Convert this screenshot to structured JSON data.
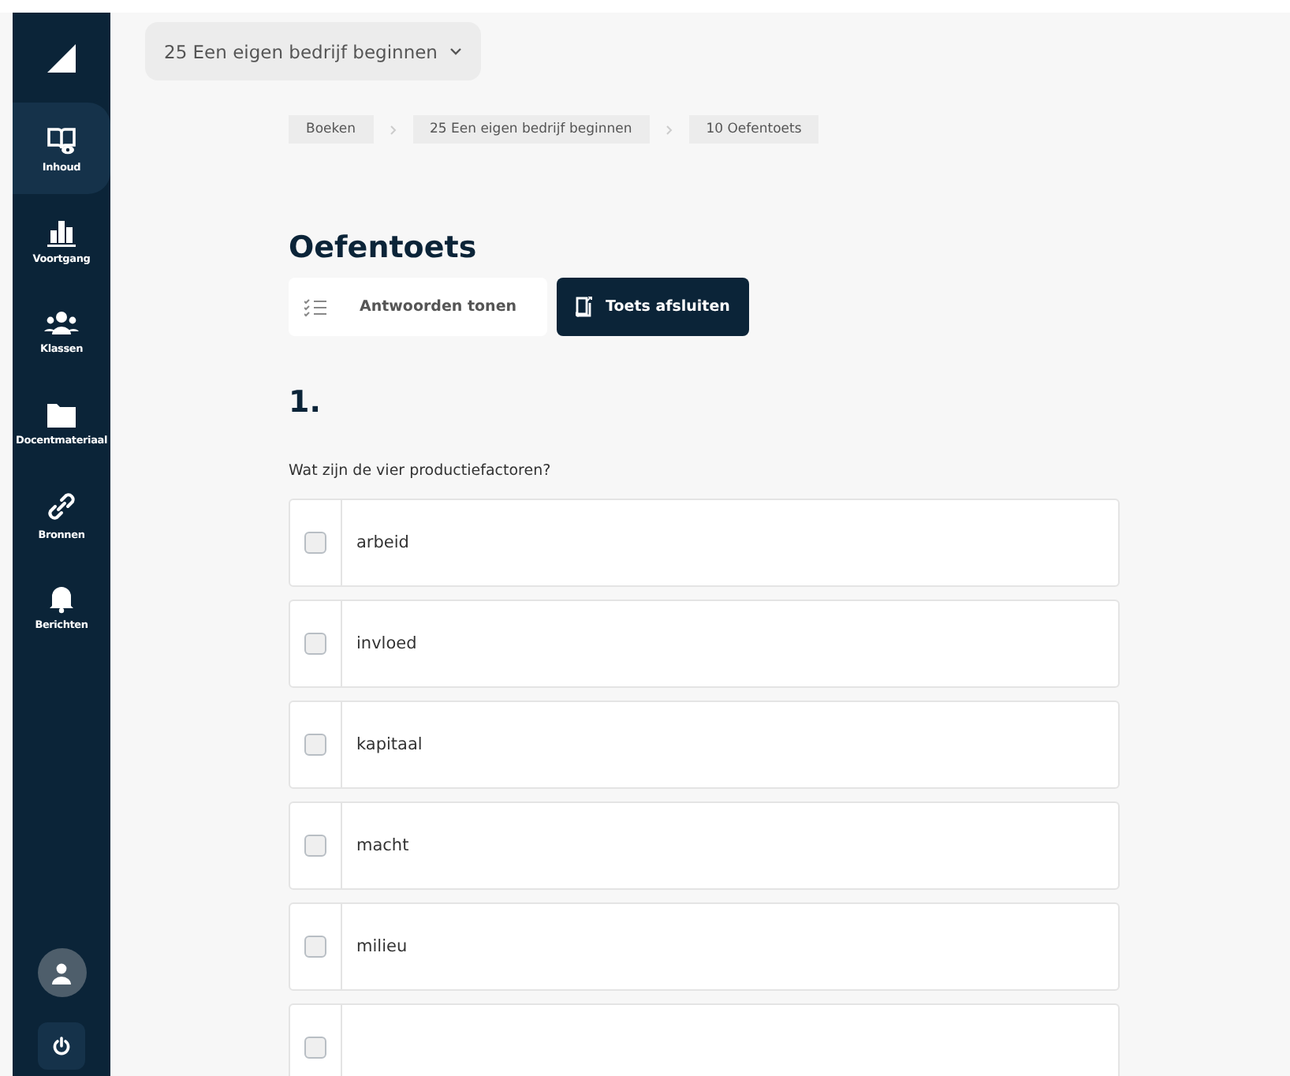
{
  "sidebar": {
    "items": [
      {
        "kind": "book",
        "label": "Inhoud",
        "selected": true
      },
      {
        "kind": "chart",
        "label": "Voortgang",
        "selected": false
      },
      {
        "kind": "people",
        "label": "Klassen",
        "selected": false
      },
      {
        "kind": "folder",
        "label": "Docentmateriaal",
        "selected": false
      },
      {
        "kind": "link",
        "label": "Bronnen",
        "selected": false
      },
      {
        "kind": "bell",
        "label": "Berichten",
        "selected": false
      }
    ]
  },
  "book_selector": {
    "label": "25 Een eigen bedrijf beginnen"
  },
  "breadcrumbs": [
    "Boeken",
    "25 Een eigen bedrijf beginnen",
    "10 Oefentoets"
  ],
  "title": "Oefentoets",
  "buttons": [
    {
      "kind": "secondary",
      "label": "Antwoorden tonen"
    },
    {
      "kind": "primary",
      "label": "Toets afsluiten"
    }
  ],
  "question": {
    "number": "1.",
    "text": "Wat zijn de vier productiefactoren?",
    "options": [
      {
        "label": "arbeid",
        "checked": false
      },
      {
        "label": "invloed",
        "checked": false
      },
      {
        "label": "kapitaal",
        "checked": false
      },
      {
        "label": "macht",
        "checked": false
      },
      {
        "label": "milieu",
        "checked": false
      },
      {
        "checked": false
      }
    ]
  }
}
